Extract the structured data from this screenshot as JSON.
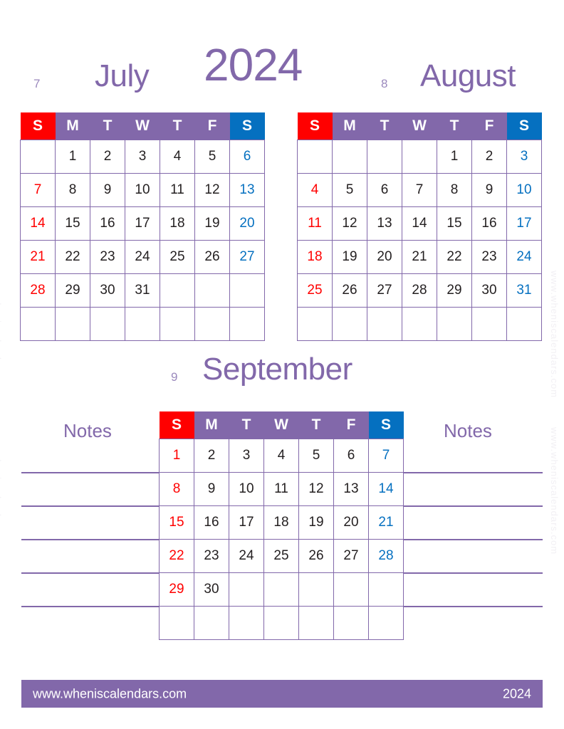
{
  "page": {
    "year_title": "2024",
    "watermark_text": "www.wheniscalendars.com"
  },
  "weekday_headers": [
    "S",
    "M",
    "T",
    "W",
    "T",
    "F",
    "S"
  ],
  "months": [
    {
      "number": "7",
      "name": "July",
      "weeks": [
        [
          "",
          "1",
          "2",
          "3",
          "4",
          "5",
          "6"
        ],
        [
          "7",
          "8",
          "9",
          "10",
          "11",
          "12",
          "13"
        ],
        [
          "14",
          "15",
          "16",
          "17",
          "18",
          "19",
          "20"
        ],
        [
          "21",
          "22",
          "23",
          "24",
          "25",
          "26",
          "27"
        ],
        [
          "28",
          "29",
          "30",
          "31",
          "",
          "",
          ""
        ],
        [
          "",
          "",
          "",
          "",
          "",
          "",
          ""
        ]
      ]
    },
    {
      "number": "8",
      "name": "August",
      "weeks": [
        [
          "",
          "",
          "",
          "",
          "1",
          "2",
          "3"
        ],
        [
          "4",
          "5",
          "6",
          "7",
          "8",
          "9",
          "10"
        ],
        [
          "11",
          "12",
          "13",
          "14",
          "15",
          "16",
          "17"
        ],
        [
          "18",
          "19",
          "20",
          "21",
          "22",
          "23",
          "24"
        ],
        [
          "25",
          "26",
          "27",
          "28",
          "29",
          "30",
          "31"
        ],
        [
          "",
          "",
          "",
          "",
          "",
          "",
          ""
        ]
      ]
    },
    {
      "number": "9",
      "name": "September",
      "weeks": [
        [
          "1",
          "2",
          "3",
          "4",
          "5",
          "6",
          "7"
        ],
        [
          "8",
          "9",
          "10",
          "11",
          "12",
          "13",
          "14"
        ],
        [
          "15",
          "16",
          "17",
          "18",
          "19",
          "20",
          "21"
        ],
        [
          "22",
          "23",
          "24",
          "25",
          "26",
          "27",
          "28"
        ],
        [
          "29",
          "30",
          "",
          "",
          "",
          "",
          ""
        ],
        [
          "",
          "",
          "",
          "",
          "",
          "",
          ""
        ]
      ]
    }
  ],
  "notes": {
    "left_label": "Notes",
    "right_label": "Notes",
    "line_count": 5
  },
  "footer": {
    "url": "www.wheniscalendars.com",
    "year": "2024"
  },
  "colors": {
    "purple": "#8268aa",
    "sunday_red": "#ff0000",
    "saturday_blue": "#0570c0",
    "weekday_text": "#231f20",
    "month_number": "#9b89bd",
    "page_background": "#ffffff"
  }
}
